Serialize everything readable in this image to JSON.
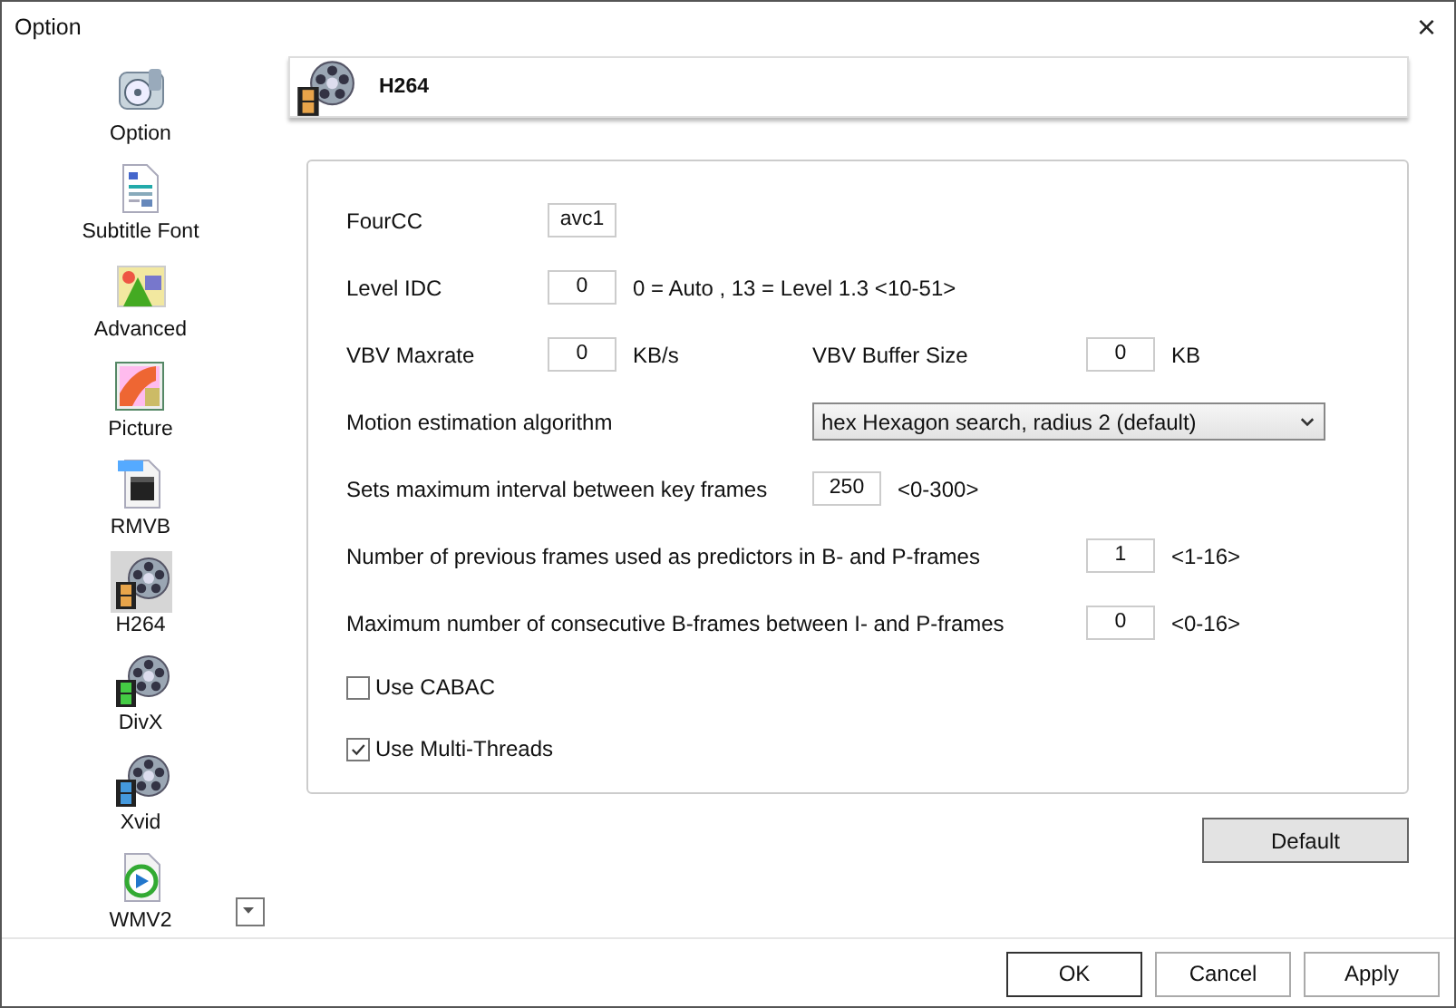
{
  "window": {
    "title": "Option",
    "close": "×"
  },
  "sidebar": {
    "items": [
      {
        "label": "Option",
        "selected": false
      },
      {
        "label": "Subtitle Font",
        "selected": false
      },
      {
        "label": "Advanced",
        "selected": false
      },
      {
        "label": "Picture",
        "selected": false
      },
      {
        "label": "RMVB",
        "selected": false
      },
      {
        "label": "H264",
        "selected": true
      },
      {
        "label": "DivX",
        "selected": false
      },
      {
        "label": "Xvid",
        "selected": false
      },
      {
        "label": "WMV2",
        "selected": false
      }
    ]
  },
  "header": {
    "title": "H264"
  },
  "settings": [
    {
      "kind": "field",
      "label": "FourCC",
      "value": "avc1"
    },
    {
      "kind": "field",
      "label": "Level IDC",
      "value": "0",
      "note": "0 = Auto , 13 = Level 1.3 <10-51>"
    },
    {
      "kind": "pair",
      "label": "VBV Maxrate",
      "value": "0",
      "note": "KB/s",
      "label_2": "VBV Buffer Size",
      "value_2": "0",
      "note_2": "KB"
    },
    {
      "kind": "select",
      "label": "Motion estimation algorithm",
      "value": "hex  Hexagon search, radius 2 (default)"
    },
    {
      "kind": "mid_field",
      "label": "Sets maximum interval between key frames",
      "value": "250",
      "note": "<0-300>"
    },
    {
      "kind": "far_field",
      "label": "Number of previous frames used as predictors in B- and P-frames",
      "value": "1",
      "note": "<1-16>"
    },
    {
      "kind": "far_field",
      "label": "Maximum number of consecutive B-frames between I- and P-frames",
      "value": "0",
      "note": "<0-16>"
    },
    {
      "kind": "checkbox",
      "label": "Use CABAC",
      "checked": false
    },
    {
      "kind": "checkbox",
      "label": "Use Multi-Threads",
      "checked": true
    }
  ],
  "default_button": "Default",
  "buttons": [
    "OK",
    "Cancel",
    "Apply"
  ]
}
